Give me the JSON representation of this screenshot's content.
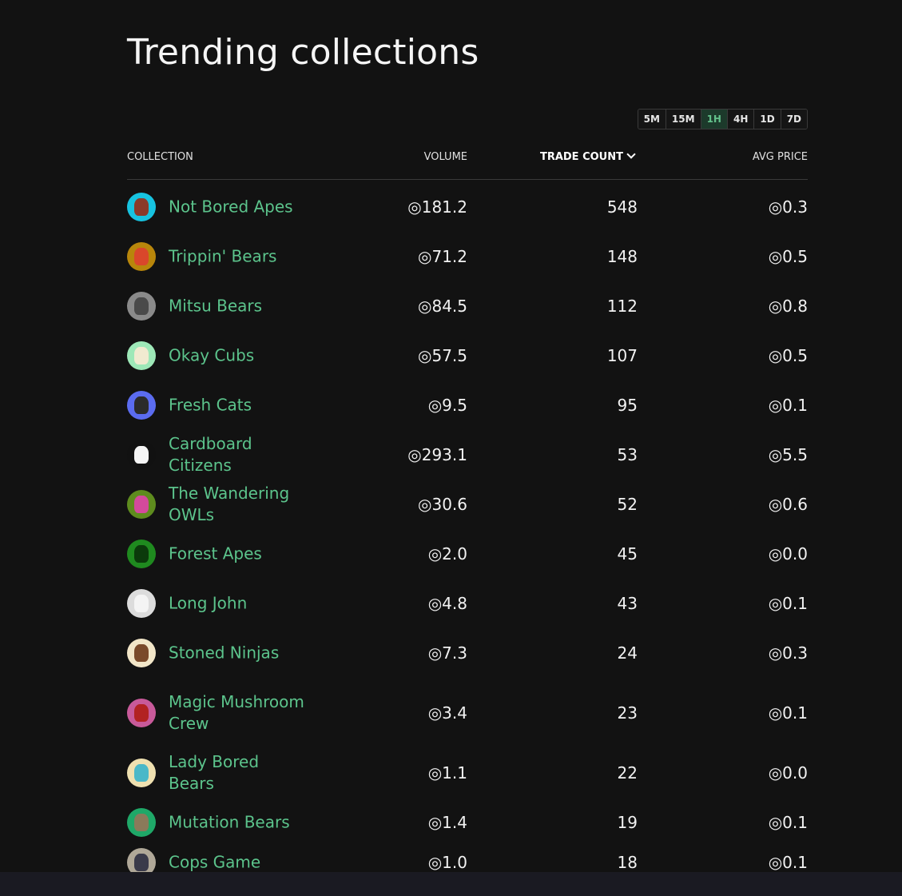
{
  "page": {
    "title": "Trending collections"
  },
  "time_filter": {
    "options": [
      "5M",
      "15M",
      "1H",
      "4H",
      "1D",
      "7D"
    ],
    "selected": "1H"
  },
  "table": {
    "headers": {
      "collection": "COLLECTION",
      "volume": "VOLUME",
      "trade_count": "TRADE COUNT",
      "avg_price": "AVG PRICE"
    },
    "currency_symbol": "◎",
    "rows": [
      {
        "name": "Not Bored Apes",
        "volume": "◎181.2",
        "trade_count": "548",
        "avg_price": "◎0.3",
        "avatar_bg": "#17c3e0",
        "avatar_fg": "#8b3a2a"
      },
      {
        "name": "Trippin' Bears",
        "volume": "◎71.2",
        "trade_count": "148",
        "avg_price": "◎0.5",
        "avatar_bg": "#b8860b",
        "avatar_fg": "#d9472b"
      },
      {
        "name": "Mitsu Bears",
        "volume": "◎84.5",
        "trade_count": "112",
        "avg_price": "◎0.8",
        "avatar_bg": "#8a8a8a",
        "avatar_fg": "#4a4a4a"
      },
      {
        "name": "Okay Cubs",
        "volume": "◎57.5",
        "trade_count": "107",
        "avg_price": "◎0.5",
        "avatar_bg": "#9ee8b8",
        "avatar_fg": "#f0ead0"
      },
      {
        "name": "Fresh Cats",
        "volume": "◎9.5",
        "trade_count": "95",
        "avg_price": "◎0.1",
        "avatar_bg": "#5b6cf0",
        "avatar_fg": "#2b2b2b"
      },
      {
        "name": "Cardboard Citizens",
        "volume": "◎293.1",
        "trade_count": "53",
        "avg_price": "◎5.5",
        "avatar_bg": "#111111",
        "avatar_fg": "#f5f5f5"
      },
      {
        "name": "The Wandering OWLs",
        "volume": "◎30.6",
        "trade_count": "52",
        "avg_price": "◎0.6",
        "avatar_bg": "#5e8c1e",
        "avatar_fg": "#d44a9c"
      },
      {
        "name": "Forest Apes",
        "volume": "◎2.0",
        "trade_count": "45",
        "avg_price": "◎0.0",
        "avatar_bg": "#1f8a1f",
        "avatar_fg": "#0b3a0b"
      },
      {
        "name": "Long John",
        "volume": "◎4.8",
        "trade_count": "43",
        "avg_price": "◎0.1",
        "avatar_bg": "#dcdcdc",
        "avatar_fg": "#f4f4f4"
      },
      {
        "name": "Stoned Ninjas",
        "volume": "◎7.3",
        "trade_count": "24",
        "avg_price": "◎0.3",
        "avatar_bg": "#f2e6c8",
        "avatar_fg": "#7a4a2a"
      },
      {
        "name": "Magic Mushroom Crew",
        "volume": "◎3.4",
        "trade_count": "23",
        "avg_price": "◎0.1",
        "avatar_bg": "#c85a9a",
        "avatar_fg": "#b22222"
      },
      {
        "name": "Lady Bored Bears",
        "volume": "◎1.1",
        "trade_count": "22",
        "avg_price": "◎0.0",
        "avatar_bg": "#efe0b0",
        "avatar_fg": "#4ab8c8"
      },
      {
        "name": "Mutation Bears",
        "volume": "◎1.4",
        "trade_count": "19",
        "avg_price": "◎0.1",
        "avatar_bg": "#1fa868",
        "avatar_fg": "#8a7a5a"
      },
      {
        "name": "Cops Game",
        "volume": "◎1.0",
        "trade_count": "18",
        "avg_price": "◎0.1",
        "avatar_bg": "#b0a898",
        "avatar_fg": "#3a3a4a"
      }
    ]
  }
}
